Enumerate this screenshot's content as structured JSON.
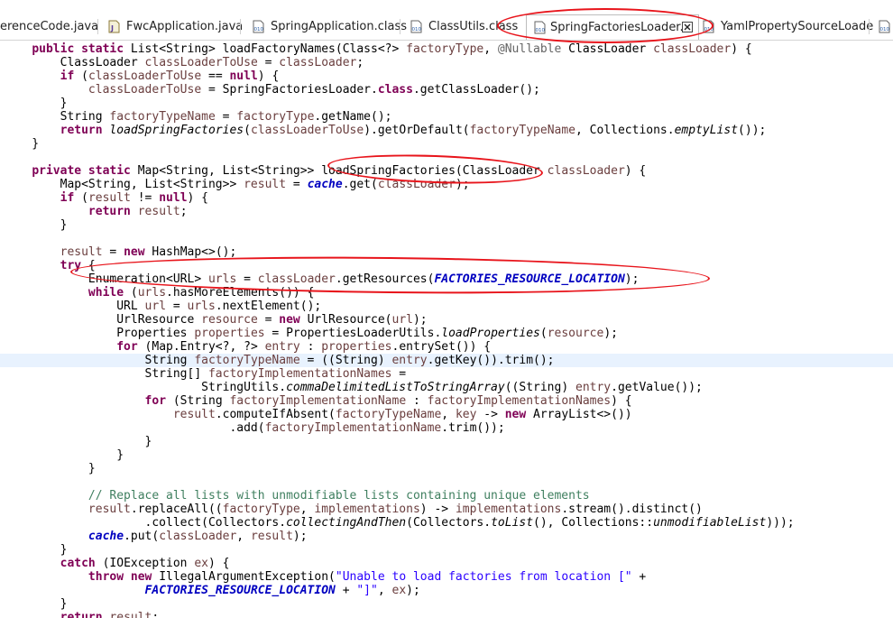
{
  "tabs": [
    {
      "label": "erenceCode.java",
      "icon": "java-file-icon",
      "active": false
    },
    {
      "label": "FwcApplication.java",
      "icon": "java-file-icon",
      "active": false
    },
    {
      "label": "SpringApplication.class",
      "icon": "class-file-icon",
      "active": false
    },
    {
      "label": "ClassUtils.class",
      "icon": "class-file-icon",
      "active": false
    },
    {
      "label": "SpringFactoriesLoader.cl",
      "icon": "class-file-icon",
      "active": true
    },
    {
      "label": "YamlPropertySourceLoade",
      "icon": "class-file-icon",
      "active": false
    }
  ],
  "annotation_color": "#e8141b",
  "code_lines": [
    [
      [
        "    ",
        ""
      ],
      [
        "public static",
        "kw"
      ],
      [
        " List<String> loadFactoryNames(Class<?> ",
        ""
      ],
      [
        "factoryType",
        "var"
      ],
      [
        ", ",
        ""
      ],
      [
        "@Nullable",
        "ann"
      ],
      [
        " ClassLoader ",
        ""
      ],
      [
        "classLoader",
        "var"
      ],
      [
        ") {",
        ""
      ]
    ],
    [
      [
        "        ClassLoader ",
        ""
      ],
      [
        "classLoaderToUse",
        "var"
      ],
      [
        " = ",
        ""
      ],
      [
        "classLoader",
        "var"
      ],
      [
        ";",
        ""
      ]
    ],
    [
      [
        "        ",
        ""
      ],
      [
        "if",
        "kw"
      ],
      [
        " (",
        ""
      ],
      [
        "classLoaderToUse",
        "var"
      ],
      [
        " == ",
        ""
      ],
      [
        "null",
        "kw"
      ],
      [
        ") {",
        ""
      ]
    ],
    [
      [
        "            ",
        ""
      ],
      [
        "classLoaderToUse",
        "var"
      ],
      [
        " = SpringFactoriesLoader.",
        ""
      ],
      [
        "class",
        "kw"
      ],
      [
        ".getClassLoader();",
        ""
      ]
    ],
    [
      [
        "        }",
        ""
      ]
    ],
    [
      [
        "        String ",
        ""
      ],
      [
        "factoryTypeName",
        "var"
      ],
      [
        " = ",
        ""
      ],
      [
        "factoryType",
        "var"
      ],
      [
        ".getName();",
        ""
      ]
    ],
    [
      [
        "        ",
        ""
      ],
      [
        "return",
        "kw"
      ],
      [
        " ",
        ""
      ],
      [
        "loadSpringFactories",
        "sm"
      ],
      [
        "(",
        ""
      ],
      [
        "classLoaderToUse",
        "var"
      ],
      [
        ").getOrDefault(",
        ""
      ],
      [
        "factoryTypeName",
        "var"
      ],
      [
        ", Collections.",
        ""
      ],
      [
        "emptyList",
        "sm"
      ],
      [
        "());",
        ""
      ]
    ],
    [
      [
        "    }",
        ""
      ]
    ],
    [],
    [
      [
        "    ",
        ""
      ],
      [
        "private static",
        "kw"
      ],
      [
        " Map<String, List<String>> loadSpringFactories(ClassLoader ",
        ""
      ],
      [
        "classLoader",
        "var"
      ],
      [
        ") {",
        ""
      ]
    ],
    [
      [
        "        Map<String, List<String>> ",
        ""
      ],
      [
        "result",
        "var"
      ],
      [
        " = ",
        ""
      ],
      [
        "cache",
        "fld"
      ],
      [
        ".get(",
        ""
      ],
      [
        "classLoader",
        "var"
      ],
      [
        ");",
        ""
      ]
    ],
    [
      [
        "        ",
        ""
      ],
      [
        "if",
        "kw"
      ],
      [
        " (",
        ""
      ],
      [
        "result",
        "var"
      ],
      [
        " != ",
        ""
      ],
      [
        "null",
        "kw"
      ],
      [
        ") {",
        ""
      ]
    ],
    [
      [
        "            ",
        ""
      ],
      [
        "return",
        "kw"
      ],
      [
        " ",
        ""
      ],
      [
        "result",
        "var"
      ],
      [
        ";",
        ""
      ]
    ],
    [
      [
        "        }",
        ""
      ]
    ],
    [],
    [
      [
        "        ",
        ""
      ],
      [
        "result",
        "var"
      ],
      [
        " = ",
        ""
      ],
      [
        "new",
        "kw"
      ],
      [
        " HashMap<>();",
        ""
      ]
    ],
    [
      [
        "        ",
        ""
      ],
      [
        "try",
        "kw"
      ],
      [
        " {",
        ""
      ]
    ],
    [
      [
        "            Enumeration<URL> ",
        ""
      ],
      [
        "urls",
        "var"
      ],
      [
        " = ",
        ""
      ],
      [
        "classLoader",
        "var"
      ],
      [
        ".getResources(",
        ""
      ],
      [
        "FACTORIES_RESOURCE_LOCATION",
        "fld"
      ],
      [
        ");",
        ""
      ]
    ],
    [
      [
        "            ",
        ""
      ],
      [
        "while",
        "kw"
      ],
      [
        " (",
        ""
      ],
      [
        "urls",
        "var"
      ],
      [
        ".hasMoreElements()) {",
        ""
      ]
    ],
    [
      [
        "                URL ",
        ""
      ],
      [
        "url",
        "var"
      ],
      [
        " = ",
        ""
      ],
      [
        "urls",
        "var"
      ],
      [
        ".nextElement();",
        ""
      ]
    ],
    [
      [
        "                UrlResource ",
        ""
      ],
      [
        "resource",
        "var"
      ],
      [
        " = ",
        ""
      ],
      [
        "new",
        "kw"
      ],
      [
        " UrlResource(",
        ""
      ],
      [
        "url",
        "var"
      ],
      [
        ");",
        ""
      ]
    ],
    [
      [
        "                Properties ",
        ""
      ],
      [
        "properties",
        "var"
      ],
      [
        " = PropertiesLoaderUtils.",
        ""
      ],
      [
        "loadProperties",
        "sm"
      ],
      [
        "(",
        ""
      ],
      [
        "resource",
        "var"
      ],
      [
        ");",
        ""
      ]
    ],
    [
      [
        "                ",
        ""
      ],
      [
        "for",
        "kw"
      ],
      [
        " (Map.Entry<?, ?> ",
        ""
      ],
      [
        "entry",
        "var"
      ],
      [
        " : ",
        ""
      ],
      [
        "properties",
        "var"
      ],
      [
        ".entrySet()) {",
        ""
      ]
    ],
    [
      [
        "                    String ",
        ""
      ],
      [
        "factoryTypeName",
        "var"
      ],
      [
        " = ((String) ",
        ""
      ],
      [
        "entry",
        "var"
      ],
      [
        ".getKey()).trim();",
        ""
      ]
    ],
    [
      [
        "                    String[] ",
        ""
      ],
      [
        "factoryImplementationNames",
        "var"
      ],
      [
        " =",
        ""
      ]
    ],
    [
      [
        "                            StringUtils.",
        ""
      ],
      [
        "commaDelimitedListToStringArray",
        "sm"
      ],
      [
        "((String) ",
        ""
      ],
      [
        "entry",
        "var"
      ],
      [
        ".getValue());",
        ""
      ]
    ],
    [
      [
        "                    ",
        ""
      ],
      [
        "for",
        "kw"
      ],
      [
        " (String ",
        ""
      ],
      [
        "factoryImplementationName",
        "var"
      ],
      [
        " : ",
        ""
      ],
      [
        "factoryImplementationNames",
        "var"
      ],
      [
        ") {",
        ""
      ]
    ],
    [
      [
        "                        ",
        ""
      ],
      [
        "result",
        "var"
      ],
      [
        ".computeIfAbsent(",
        ""
      ],
      [
        "factoryTypeName",
        "var"
      ],
      [
        ", ",
        ""
      ],
      [
        "key",
        "var"
      ],
      [
        " -> ",
        ""
      ],
      [
        "new",
        "kw"
      ],
      [
        " ArrayList<>())",
        ""
      ]
    ],
    [
      [
        "                                .add(",
        ""
      ],
      [
        "factoryImplementationName",
        "var"
      ],
      [
        ".trim());",
        ""
      ]
    ],
    [
      [
        "                    }",
        ""
      ]
    ],
    [
      [
        "                }",
        ""
      ]
    ],
    [
      [
        "            }",
        ""
      ]
    ],
    [],
    [
      [
        "            ",
        ""
      ],
      [
        "// Replace all lists with unmodifiable lists containing unique elements",
        "cm"
      ]
    ],
    [
      [
        "            ",
        ""
      ],
      [
        "result",
        "var"
      ],
      [
        ".replaceAll((",
        ""
      ],
      [
        "factoryType",
        "var"
      ],
      [
        ", ",
        ""
      ],
      [
        "implementations",
        "var"
      ],
      [
        ") -> ",
        ""
      ],
      [
        "implementations",
        "var"
      ],
      [
        ".stream().distinct()",
        ""
      ]
    ],
    [
      [
        "                    .collect(Collectors.",
        ""
      ],
      [
        "collectingAndThen",
        "sm"
      ],
      [
        "(Collectors.",
        ""
      ],
      [
        "toList",
        "sm"
      ],
      [
        "(), Collections::",
        ""
      ],
      [
        "unmodifiableList",
        "sm"
      ],
      [
        ")));",
        ""
      ]
    ],
    [
      [
        "            ",
        ""
      ],
      [
        "cache",
        "fld"
      ],
      [
        ".put(",
        ""
      ],
      [
        "classLoader",
        "var"
      ],
      [
        ", ",
        ""
      ],
      [
        "result",
        "var"
      ],
      [
        ");",
        ""
      ]
    ],
    [
      [
        "        }",
        ""
      ]
    ],
    [
      [
        "        ",
        ""
      ],
      [
        "catch",
        "kw"
      ],
      [
        " (IOException ",
        ""
      ],
      [
        "ex",
        "var"
      ],
      [
        ") {",
        ""
      ]
    ],
    [
      [
        "            ",
        ""
      ],
      [
        "throw",
        "kw"
      ],
      [
        " ",
        ""
      ],
      [
        "new",
        "kw"
      ],
      [
        " IllegalArgumentException(",
        ""
      ],
      [
        "\"Unable to load factories from location [\"",
        "str"
      ],
      [
        " +",
        ""
      ]
    ],
    [
      [
        "                    ",
        ""
      ],
      [
        "FACTORIES_RESOURCE_LOCATION",
        "fld"
      ],
      [
        " + ",
        ""
      ],
      [
        "\"]\"",
        "str"
      ],
      [
        ", ",
        ""
      ],
      [
        "ex",
        "var"
      ],
      [
        ");",
        ""
      ]
    ],
    [
      [
        "        }",
        ""
      ]
    ],
    [
      [
        "        ",
        ""
      ],
      [
        "return",
        "kw"
      ],
      [
        " ",
        ""
      ],
      [
        "result",
        "var"
      ],
      [
        ";",
        ""
      ]
    ]
  ]
}
